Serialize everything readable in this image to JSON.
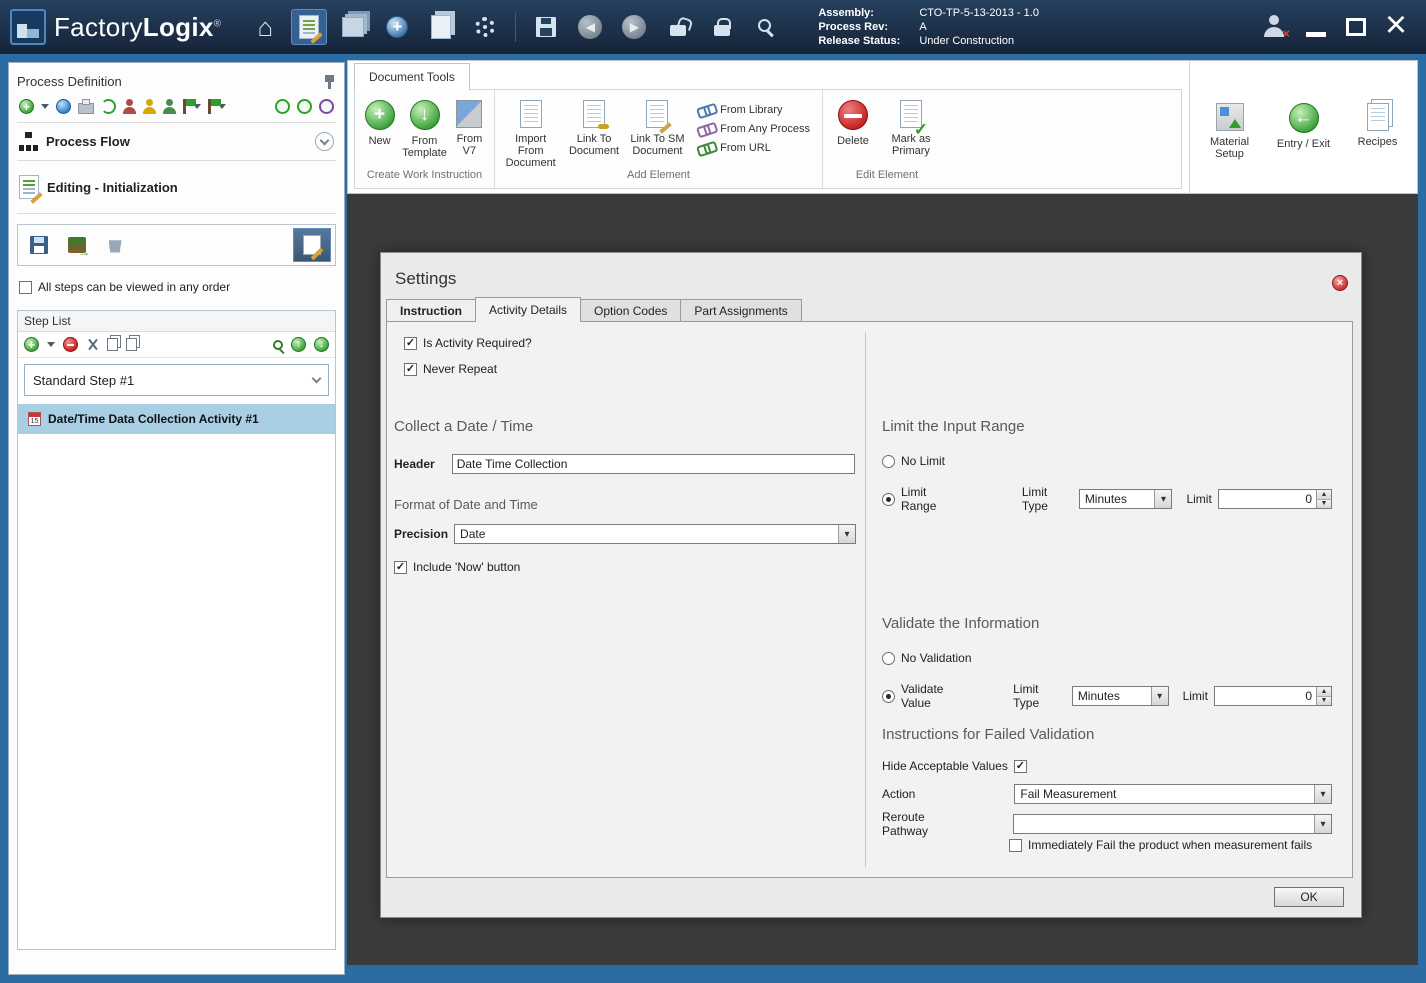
{
  "titlebar": {
    "app_name_factory": "Factory",
    "app_name_logix": "Logix",
    "app_reg": "®",
    "info": {
      "assembly_label": "Assembly:",
      "assembly_value": "CTO-TP-5-13-2013 - 1.0",
      "process_rev_label": "Process Rev:",
      "process_rev_value": "A",
      "release_status_label": "Release Status:",
      "release_status_value": "Under Construction"
    }
  },
  "sidebar": {
    "title": "Process Definition",
    "process_flow": "Process Flow",
    "editing": "Editing - Initialization",
    "order_checkbox": "All steps can be viewed in any order",
    "step_list": {
      "title": "Step List",
      "step": "Standard Step #1",
      "activity": "Date/Time Data Collection Activity #1"
    }
  },
  "ribbon": {
    "tab": "Document Tools",
    "create_group": {
      "label": "Create Work Instruction",
      "new": "New",
      "from_template": "From Template",
      "from_v7": "From V7"
    },
    "add_group": {
      "label": "Add Element",
      "import_from_document": "Import From Document",
      "link_to_document": "Link To Document",
      "link_to_sm_document": "Link To SM Document",
      "from_library": "From Library",
      "from_any_process": "From Any Process",
      "from_url": "From URL"
    },
    "edit_group": {
      "label": "Edit Element",
      "delete": "Delete",
      "mark_as_primary": "Mark as Primary"
    },
    "right_group": {
      "material_setup": "Material Setup",
      "entry_exit": "Entry / Exit",
      "recipes": "Recipes"
    }
  },
  "dialog": {
    "title": "Settings",
    "tabs": {
      "instruction": "Instruction",
      "activity_details": "Activity Details",
      "option_codes": "Option Codes",
      "part_assignments": "Part Assignments"
    },
    "is_activity_required": "Is Activity Required?",
    "never_repeat": "Never Repeat",
    "collect": {
      "title": "Collect a Date / Time",
      "header_label": "Header",
      "header_value": "Date Time Collection",
      "format_title": "Format of Date and Time",
      "precision_label": "Precision",
      "precision_value": "Date",
      "include_now": "Include 'Now' button"
    },
    "limit": {
      "title": "Limit the Input Range",
      "no_limit": "No Limit",
      "limit_range": "Limit Range",
      "limit_type_label": "Limit Type",
      "limit_type_value": "Minutes",
      "limit_label": "Limit",
      "limit_value": "0"
    },
    "validate": {
      "title": "Validate the Information",
      "no_validation": "No Validation",
      "validate_value": "Validate Value",
      "limit_type_label": "Limit Type",
      "limit_type_value": "Minutes",
      "limit_label": "Limit",
      "limit_value": "0"
    },
    "failed": {
      "title": "Instructions for Failed Validation",
      "hide_acceptable": "Hide Acceptable Values",
      "action_label": "Action",
      "action_value": "Fail Measurement",
      "reroute_label": "Reroute Pathway",
      "reroute_value": "",
      "immediately_fail": "Immediately Fail the product when measurement fails"
    },
    "ok": "OK"
  }
}
